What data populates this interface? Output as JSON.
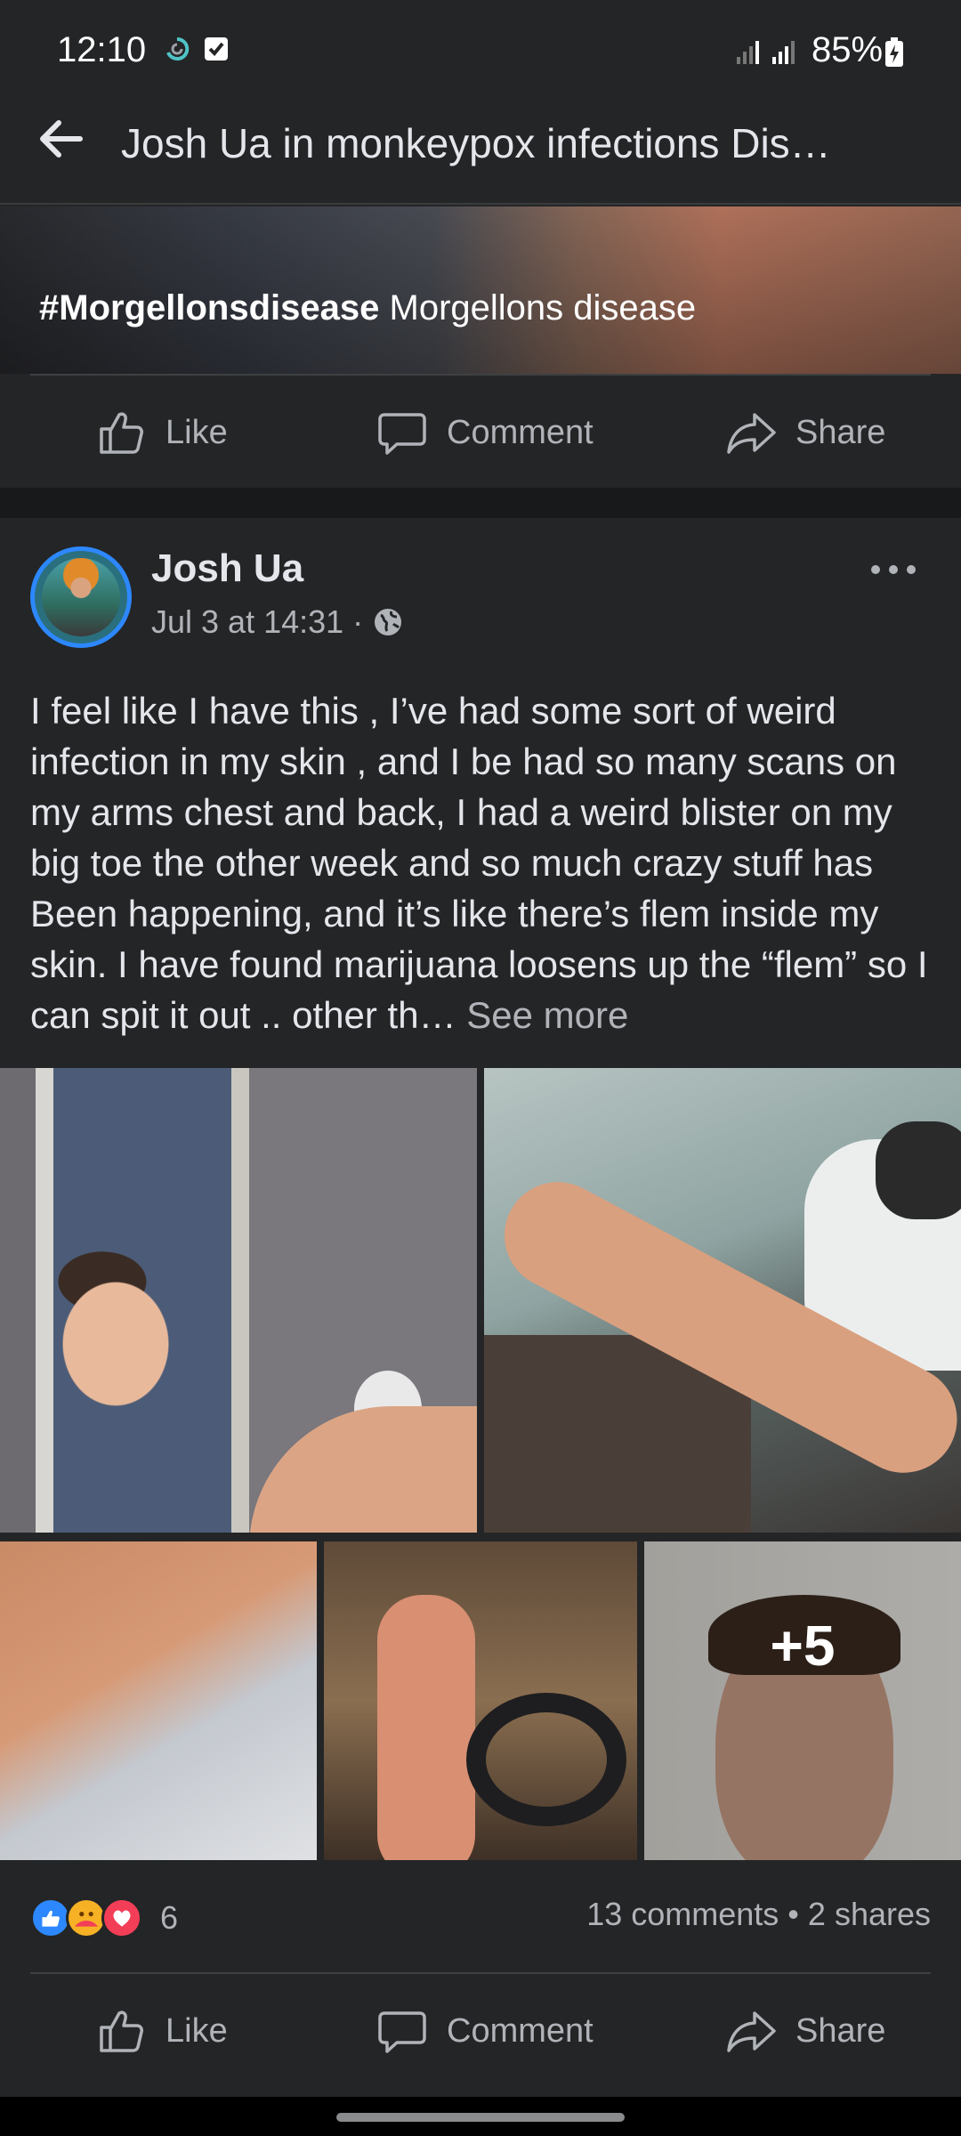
{
  "status_bar": {
    "time": "12:10",
    "battery": "85%",
    "icons": [
      "sync-icon",
      "checkbox-icon",
      "signal-icon",
      "signal-icon",
      "battery-icon"
    ]
  },
  "header": {
    "title": "Josh Ua in monkeypox infections Dis…"
  },
  "previous_post": {
    "hashtag": "#Morgellonsdisease",
    "caption": "Morgellons disease",
    "actions": {
      "like": "Like",
      "comment": "Comment",
      "share": "Share"
    }
  },
  "post": {
    "author": "Josh Ua",
    "timestamp": "Jul 3 at 14:31",
    "separator": "·",
    "text": "I feel like I have this , I’ve had some sort of weird infection in my skin , and I be had so many scans on my arms chest and back, I had a weird blister on my big toe the other week and so much crazy stuff has Been happening, and it’s like there’s flem inside my skin. I have found marijuana loosens up the “flem” so I can spit it out .. other th… ",
    "see_more": "See more",
    "photos": {
      "extra_count": "+5"
    },
    "reactions": {
      "count": "6",
      "icons": [
        "like-reaction-icon",
        "care-reaction-icon",
        "love-reaction-icon"
      ],
      "colors": {
        "like": "#2d88ff",
        "care": "#f7b125",
        "love": "#f33e58"
      }
    },
    "stats": "13 comments • 2 shares",
    "actions": {
      "like": "Like",
      "comment": "Comment",
      "share": "Share"
    }
  }
}
